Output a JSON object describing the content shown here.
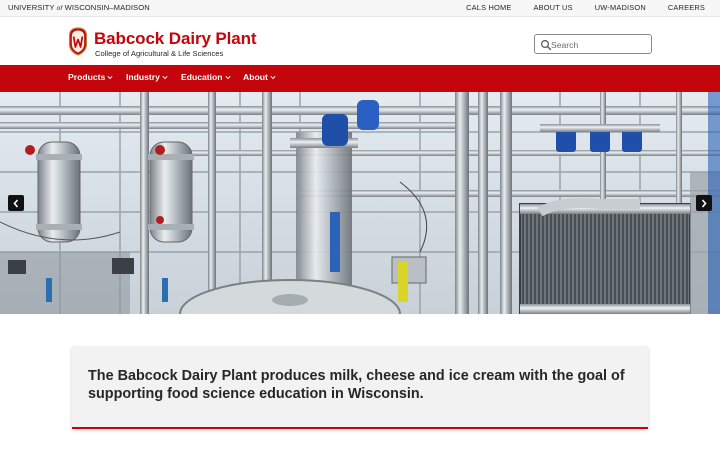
{
  "topbar": {
    "uw_prefix": "UNIVERSITY",
    "uw_of": "of",
    "uw_suffix": "WISCONSIN–MADISON",
    "links": [
      "CALS HOME",
      "ABOUT US",
      "UW-MADISON",
      "CAREERS"
    ]
  },
  "header": {
    "title": "Babcock Dairy Plant",
    "subtitle": "College of Agricultural & Life Sciences",
    "search_placeholder": "Search",
    "brand_color": "#c5050c"
  },
  "nav": {
    "items": [
      "Products",
      "Industry",
      "Education",
      "About"
    ]
  },
  "hero": {
    "prev_icon": "chevron-left-icon",
    "next_icon": "chevron-right-icon"
  },
  "intro": {
    "text": "The Babcock Dairy Plant produces milk, cheese and ice cream with the goal of supporting food science education in Wisconsin."
  }
}
